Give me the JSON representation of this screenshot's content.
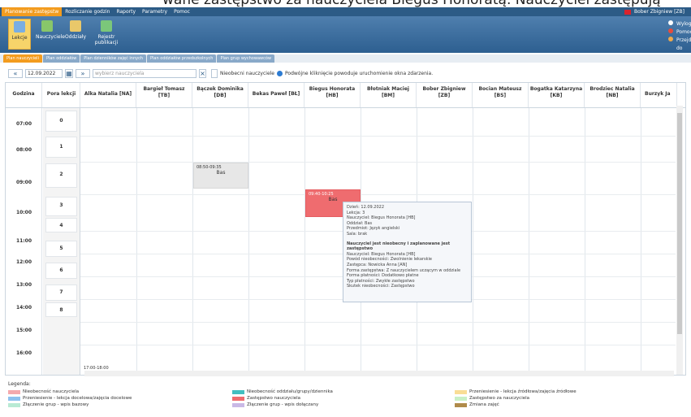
{
  "caption": "wane zastępstwo za nauczyciela Biegus Honoratą. Nauczyciel zastępują",
  "menu": [
    "Planowanie zastępstw",
    "Rozliczanie godzin",
    "Raporty",
    "Parametry",
    "Pomoc"
  ],
  "user": "Bober Zbigniew [ZB]",
  "ribbon": {
    "buttons": [
      "Lekcje",
      "Nauczyciele",
      "Oddziały",
      "Rejestr publikacji"
    ],
    "side": [
      "Wyloguj",
      "Pomoc",
      "Przejdź do"
    ]
  },
  "tabs": [
    "Plan nauczycieli",
    "Plan oddziałów",
    "Plan dzienników zajęć innych",
    "Plan oddziałów przedszkolnych",
    "Plan grup wychowawców"
  ],
  "toolbar": {
    "date": "12.09.2022",
    "teacher_placeholder": "wybierz nauczyciela",
    "absent_label": "Nieobecni nauczyciele",
    "hint": "Podwójne kliknięcie powoduje uruchomienie okna zdarzenia."
  },
  "columns": {
    "time": "Godzina",
    "lesson": "Pora lekcji",
    "teachers": [
      {
        "name": "Alka Natalia [NA]",
        "code": ""
      },
      {
        "name": "Bargieł Tomasz",
        "code": "[TB]"
      },
      {
        "name": "Bączek Dominika",
        "code": "[DB]"
      },
      {
        "name": "Bekas Paweł [BŁ]",
        "code": ""
      },
      {
        "name": "Biegus Honorata",
        "code": "[HB]"
      },
      {
        "name": "Błotniak Maciej",
        "code": "[BM]"
      },
      {
        "name": "Bober Zbigniew",
        "code": "[ZB]"
      },
      {
        "name": "Bocian Mateusz",
        "code": "[BS]"
      },
      {
        "name": "Bogatka Katarzyna",
        "code": "[KB]"
      },
      {
        "name": "Brodziec Natalia",
        "code": "[NB]"
      },
      {
        "name": "Burzyk Ja",
        "code": ""
      }
    ]
  },
  "times": [
    "07:00",
    "08:00",
    "09:00",
    "10:00",
    "11:00",
    "12:00",
    "13:00",
    "14:00",
    "15:00",
    "16:00"
  ],
  "lessons": [
    "0",
    "1",
    "2",
    "3",
    "4",
    "5",
    "6",
    "7",
    "8"
  ],
  "blocks": [
    {
      "time": "08:50-09:35",
      "label": "Bas"
    },
    {
      "time": "09:40-10:25",
      "label": "Bas"
    },
    {
      "time": "17:00-18:00",
      "label": ""
    }
  ],
  "tooltip": {
    "lines": [
      "Dzień: 12.09.2022",
      "Lekcja: 3",
      "Nauczyciel: Biegus Honorata [HB]",
      "Oddział: Bas",
      "Przedmiot: Język angielski",
      "Sala: brak"
    ],
    "title": "Nauczyciel jest nieobecny i zaplanowane jest zastępstwo",
    "details": [
      "Nauczyciel: Biegus Honorata [HB]",
      "Powód nieobecności: Zwolnienie lekarskie",
      "Zastępca: Nowicka Anna [AN]",
      "Forma zastępstwa: Z nauczycielem uczącym w oddziale",
      "Forma płatności: Dodatkowo płatne",
      "Typ płatności: Zwykłe zastępstwo",
      "Skutek nieobecności: Zastępstwo"
    ]
  },
  "legend": {
    "title": "Legenda:",
    "items": [
      {
        "label": "Nieobecność nauczyciela",
        "color": "#f4a9ad"
      },
      {
        "label": "Przeniesienie - lekcja docelowa/zajęcia docelowe",
        "color": "#8ec1ef"
      },
      {
        "label": "Złączenie grup - wpis bazowy",
        "color": "#b8ead4"
      },
      {
        "label": "Nieobecność oddziału/grupy/dziennika",
        "color": "#42bfc0"
      },
      {
        "label": "Zastępstwo nauczyciela",
        "color": "#ef6c6f"
      },
      {
        "label": "Złączenie grup - wpis dołączany",
        "color": "#c9b9e6"
      },
      {
        "label": "Przeniesienie - lekcja źródłowa/zajęcia źródłowe",
        "color": "#f9dd95"
      },
      {
        "label": "Zastępstwo za nauczyciela",
        "color": "#c9f0c6"
      },
      {
        "label": "Zmiana zajęć",
        "color": "#b08b4a"
      }
    ]
  }
}
